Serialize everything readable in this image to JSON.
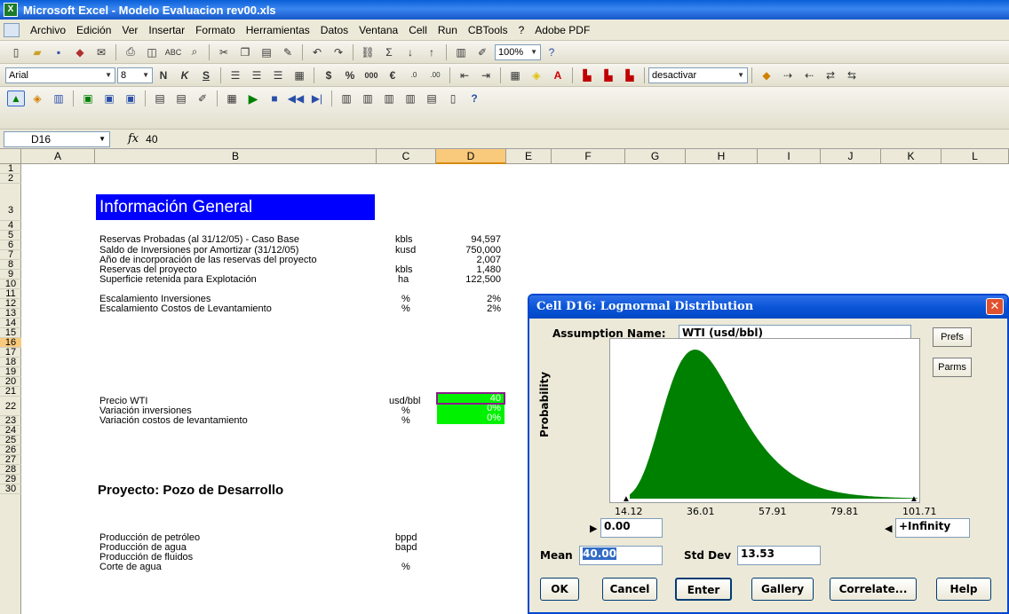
{
  "window": {
    "title": "Microsoft Excel - Modelo Evaluacion rev00.xls"
  },
  "menu": [
    "Archivo",
    "Edición",
    "Ver",
    "Insertar",
    "Formato",
    "Herramientas",
    "Datos",
    "Ventana",
    "Cell",
    "Run",
    "CBTools",
    "?",
    "Adobe PDF"
  ],
  "toolbar1": {
    "zoom": "100%"
  },
  "toolbar2": {
    "font": "Arial",
    "size": "8",
    "currency": "$",
    "percent": "%",
    "thousands": "000",
    "euro": "€",
    "dropdown": "desactivar"
  },
  "formula_bar": {
    "cell_ref": "D16",
    "fx": "fx",
    "value": "40"
  },
  "columns": [
    "A",
    "B",
    "C",
    "D",
    "E",
    "F",
    "G",
    "H",
    "I",
    "J",
    "K",
    "L"
  ],
  "rows": [
    "1",
    "2",
    "3",
    "4",
    "5",
    "6",
    "7",
    "8",
    "9",
    "10",
    "11",
    "12",
    "13",
    "14",
    "15",
    "16",
    "17",
    "18",
    "19",
    "20",
    "21",
    "22",
    "23",
    "24",
    "25",
    "26",
    "27",
    "28",
    "29",
    "30"
  ],
  "sheet": {
    "info_title": "Información General",
    "reservas": [
      {
        "label": "Reservas Probadas (al 31/12/05) - Caso Base",
        "unit": "kbls",
        "value": "94,597"
      },
      {
        "label": "Saldo de Inversiones por Amortizar (31/12/05)",
        "unit": "kusd",
        "value": "750,000"
      },
      {
        "label": "Año de incorporación de las reservas del proyecto",
        "unit": "",
        "value": "2,007"
      },
      {
        "label": "Reservas del proyecto",
        "unit": "kbls",
        "value": "1,480"
      },
      {
        "label": "Superficie retenida para Explotación",
        "unit": "ha",
        "value": "122,500"
      }
    ],
    "escalamiento": [
      {
        "label": "Escalamiento Inversiones",
        "unit": "%",
        "value": "2%"
      },
      {
        "label": "Escalamiento Costos de Levantamiento",
        "unit": "%",
        "value": "2%"
      }
    ],
    "variables": [
      {
        "label": "Precio WTI",
        "unit": "usd/bbl",
        "value": "40"
      },
      {
        "label": "Variación inversiones",
        "unit": "%",
        "value": "0%"
      },
      {
        "label": "Variación costos de levantamiento",
        "unit": "%",
        "value": "0%"
      }
    ],
    "proyecto_title": "Proyecto: Pozo de Desarrollo",
    "produccion": [
      {
        "label": "Producción de petróleo",
        "unit": "bppd"
      },
      {
        "label": "Producción de agua",
        "unit": "bapd"
      },
      {
        "label": "Producción de fluidos",
        "unit": ""
      },
      {
        "label": "Corte de agua",
        "unit": "%"
      }
    ]
  },
  "dialog": {
    "title": "Cell D16:  Lognormal Distribution",
    "close": "✕",
    "assumption_label": "Assumption Name:",
    "assumption_value": "WTI (usd/bbl)",
    "prefs": "Prefs",
    "parms": "Parms",
    "y_label": "Probability",
    "lower_bound": "0.00",
    "upper_bound": "+Infinity",
    "mean_label": "Mean",
    "mean_value": "40.00",
    "stddev_label": "Std Dev",
    "stddev_value": "13.53",
    "buttons": [
      "OK",
      "Cancel",
      "Enter",
      "Gallery",
      "Correlate...",
      "Help"
    ],
    "fill_color": "#008000"
  },
  "chart_data": {
    "type": "area",
    "distribution": "lognormal",
    "mean": 40.0,
    "std_dev": 13.53,
    "x_ticks": [
      "14.12",
      "36.01",
      "57.91",
      "79.81",
      "101.71"
    ],
    "xlim": [
      14.12,
      101.71
    ],
    "ylabel": "Probability"
  }
}
